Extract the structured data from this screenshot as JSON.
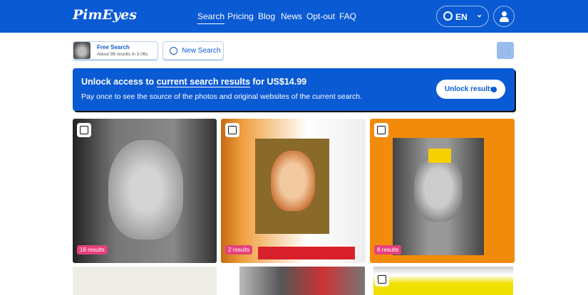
{
  "header": {
    "logo": "PimEyes",
    "nav": [
      "Search",
      "Pricing",
      "Blog",
      "News",
      "Opt-out",
      "FAQ"
    ],
    "active": "Search",
    "language": "EN"
  },
  "toolbar": {
    "free_search_title": "Free Search",
    "free_search_sub": "About 98 results in 3.06s",
    "new_search": "New Search"
  },
  "banner": {
    "title_pre": "Unlock access to ",
    "title_link": "current search results",
    "title_post": " for US$14.99",
    "subtitle": "Pay once to see the source of the photos and original websites of the current search.",
    "button": "Unlock results"
  },
  "results": [
    {
      "count": "16 results"
    },
    {
      "count": "2 results"
    },
    {
      "count": "8 results"
    }
  ],
  "colors": {
    "brand": "#0a5ad4",
    "badge": "#e6407d"
  }
}
